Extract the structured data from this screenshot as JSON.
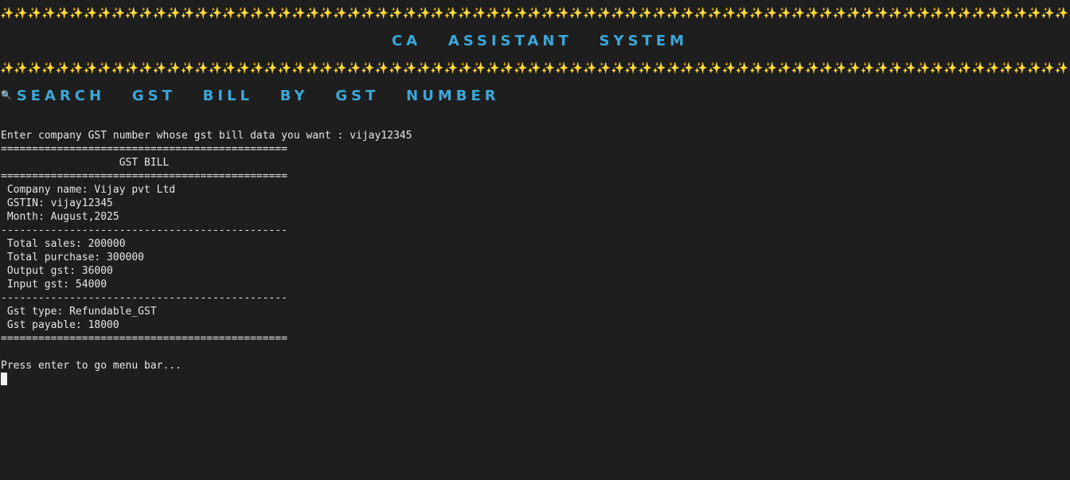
{
  "banner": {
    "sparkles_top": "✨✨✨✨✨✨✨✨✨✨✨✨✨✨✨✨✨✨✨✨✨✨✨✨✨✨✨✨✨✨✨✨✨✨✨✨✨✨✨✨✨✨✨✨✨✨✨✨✨✨✨✨✨✨✨✨✨✨✨✨✨✨✨✨✨✨✨✨✨✨✨✨✨✨✨✨✨✨✨✨✨✨✨✨✨✨✨✨✨✨✨✨✨✨✨✨",
    "title": "CA   ASSISTANT   SYSTEM",
    "sparkles_bottom": "✨✨✨✨✨✨✨✨✨✨✨✨✨✨✨✨✨✨✨✨✨✨✨✨✨✨✨✨✨✨✨✨✨✨✨✨✨✨✨✨✨✨✨✨✨✨✨✨✨✨✨✨✨✨✨✨✨✨✨✨✨✨✨✨✨✨✨✨✨✨✨✨✨✨✨✨✨✨✨✨✨✨✨✨✨✨✨✨✨✨✨✨✨✨✨✨"
  },
  "section": {
    "icon": "search-icon",
    "icon_glyph": "🔍",
    "heading": "SEARCH   GST   BILL   BY   GST   NUMBER"
  },
  "prompt": {
    "label": "Enter company GST number whose gst bill data you want : ",
    "value": "vijay12345"
  },
  "bill": {
    "rule_double": "==============================================",
    "title": "                   GST BILL",
    "rule_single": "----------------------------------------------",
    "company_name": " Company name: Vijay pvt Ltd",
    "gstin": " GSTIN: vijay12345",
    "month": " Month: August,2025",
    "total_sales": " Total sales: 200000",
    "total_purchase": " Total purchase: 300000",
    "output_gst": " Output gst: 36000",
    "input_gst": " Input gst: 54000",
    "gst_type": " Gst type: Refundable_GST",
    "gst_payable": " Gst payable: 18000"
  },
  "footer": {
    "message": "Press enter to go menu bar..."
  },
  "colors": {
    "background": "#1e1e1e",
    "text": "#e6e6e6",
    "accent": "#3aa8d8"
  }
}
